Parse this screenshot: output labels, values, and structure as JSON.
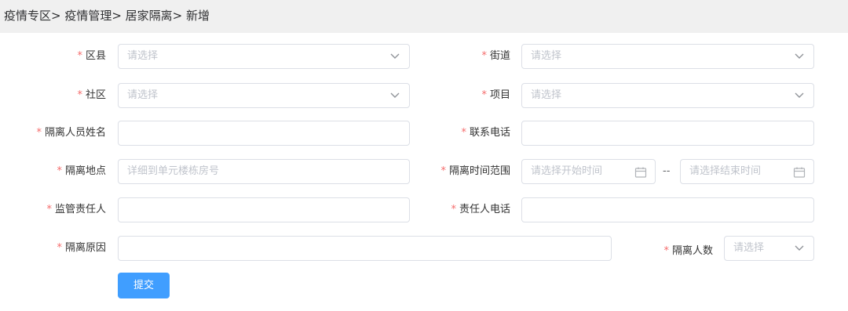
{
  "breadcrumb": "疫情专区> 疫情管理> 居家隔离> 新增",
  "required_mark": "*",
  "fields": {
    "district": {
      "label": "区县",
      "placeholder": "请选择"
    },
    "street": {
      "label": "街道",
      "placeholder": "请选择"
    },
    "community": {
      "label": "社区",
      "placeholder": "请选择"
    },
    "project": {
      "label": "项目",
      "placeholder": "请选择"
    },
    "person_name": {
      "label": "隔离人员姓名",
      "value": ""
    },
    "phone": {
      "label": "联系电话",
      "value": ""
    },
    "location": {
      "label": "隔离地点",
      "placeholder": "详细到单元楼栋房号"
    },
    "time_range": {
      "label": "隔离时间范围",
      "start_placeholder": "请选择开始时间",
      "end_placeholder": "请选择结束时间",
      "separator": "--"
    },
    "supervisor": {
      "label": "监管责任人",
      "value": ""
    },
    "supervisor_phone": {
      "label": "责任人电话",
      "value": ""
    },
    "reason": {
      "label": "隔离原因",
      "value": ""
    },
    "person_count": {
      "label": "隔离人数",
      "placeholder": "请选择"
    }
  },
  "submit_label": "提交",
  "colors": {
    "primary": "#409eff",
    "required": "#f56c6c",
    "border": "#dcdfe6",
    "placeholder": "#c0c4cc",
    "breadcrumb_bg": "#f0f0f0"
  }
}
